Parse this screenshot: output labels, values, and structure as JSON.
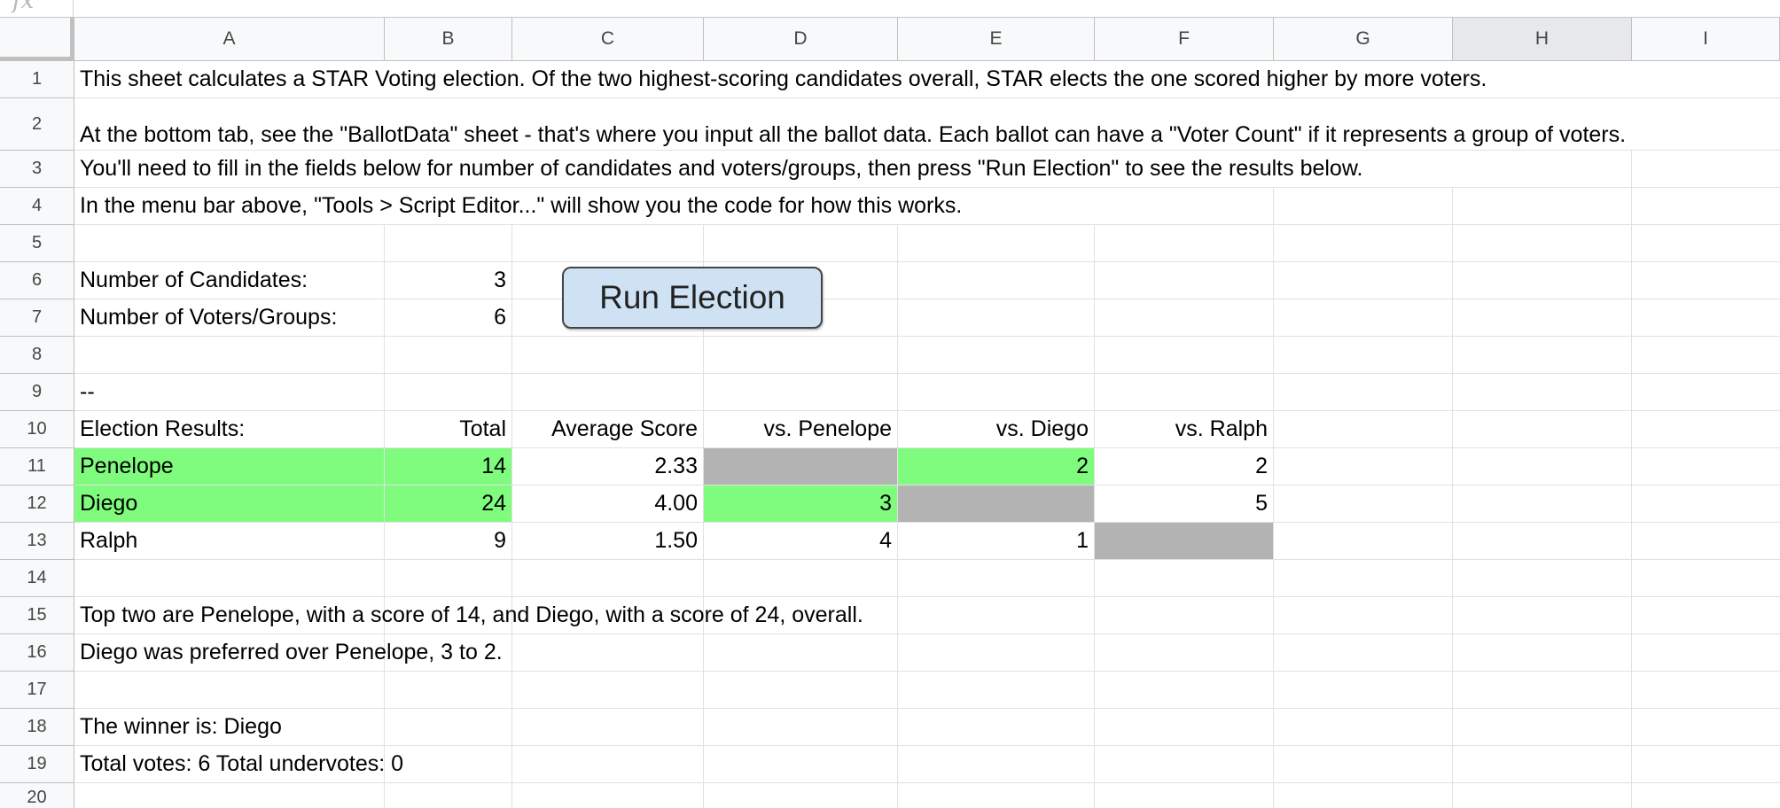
{
  "formula_bar": {
    "fx_label": "fx",
    "value": ""
  },
  "columns": [
    "A",
    "B",
    "C",
    "D",
    "E",
    "F",
    "G",
    "H",
    "I"
  ],
  "selected_column": "H",
  "rows": [
    "1",
    "2",
    "3",
    "4",
    "5",
    "6",
    "7",
    "8",
    "9",
    "10",
    "11",
    "12",
    "13",
    "14",
    "15",
    "16",
    "17",
    "18",
    "19",
    "20"
  ],
  "intro": {
    "line1": "This sheet calculates a STAR Voting election. Of the two highest-scoring candidates overall, STAR elects the one scored higher by more voters.",
    "line2": "At the bottom tab, see the \"BallotData\" sheet - that's where you input all the ballot data. Each ballot can have a \"Voter Count\" if it represents a group of voters.",
    "line3": "You'll need to fill in the fields below for number of candidates and voters/groups, then press \"Run Election\" to see the results below.",
    "line4": "In the menu bar above, \"Tools > Script Editor...\" will show you the code for how this works."
  },
  "inputs": {
    "candidates_label": "Number of Candidates:",
    "candidates_value": "3",
    "voters_label": "Number of Voters/Groups:",
    "voters_value": "6"
  },
  "run_button_label": "Run Election",
  "separator": "--",
  "results": {
    "header": [
      "Election Results:",
      "Total",
      "Average Score",
      "vs. Penelope",
      "vs. Diego",
      "vs. Ralph"
    ],
    "rows": [
      {
        "name": "Penelope",
        "total": "14",
        "average": "2.33",
        "vs_penelope": "",
        "vs_diego": "2",
        "vs_ralph": "2"
      },
      {
        "name": "Diego",
        "total": "24",
        "average": "4.00",
        "vs_penelope": "3",
        "vs_diego": "",
        "vs_ralph": "5"
      },
      {
        "name": "Ralph",
        "total": "9",
        "average": "1.50",
        "vs_penelope": "4",
        "vs_diego": "1",
        "vs_ralph": ""
      }
    ]
  },
  "summary": {
    "top_two": "Top two are Penelope, with a score of 14, and Diego, with a score of 24, overall.",
    "preferred": "Diego was preferred over Penelope, 3 to 2.",
    "winner": "The winner is: Diego",
    "totals": "Total votes: 6 Total undervotes: 0"
  },
  "colors": {
    "highlight_green": "#7ffb7e",
    "diagonal_gray": "#b3b3b3",
    "button_fill": "#cfe2f3"
  }
}
